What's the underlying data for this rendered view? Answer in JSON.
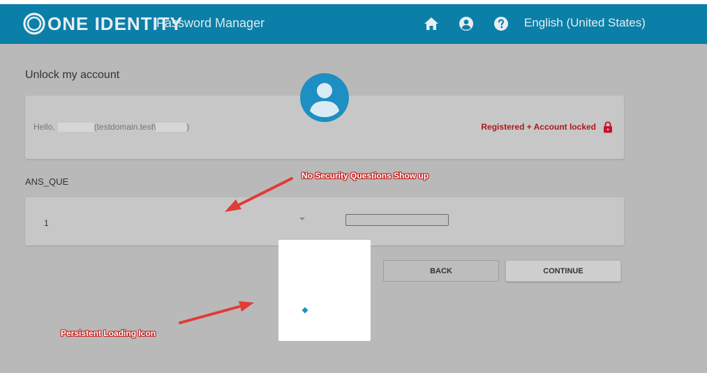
{
  "header": {
    "logo_text": "ONE IDENTITY",
    "app_name": "Password Manager",
    "language": "English (United States)",
    "icons": [
      "home-icon",
      "user-circle-icon",
      "help-icon"
    ]
  },
  "page": {
    "title": "Unlock my account"
  },
  "user_card": {
    "hello_prefix": "Hello,",
    "domain_text": "(testdomain.test\\",
    "domain_close": ")",
    "status": "Registered + Account locked"
  },
  "questions": {
    "section_label": "ANS_QUE",
    "number": "1",
    "answer_value": ""
  },
  "buttons": {
    "back": "BACK",
    "continue": "CONTINUE"
  },
  "annotations": {
    "no_questions": "No Security Questions Show up",
    "loading": "Persistent Loading Icon"
  },
  "colors": {
    "header_bg": "#0b7fa8",
    "avatar": "#1d8fc3",
    "status_red": "#b11616",
    "annotation_red": "#e03b36"
  }
}
